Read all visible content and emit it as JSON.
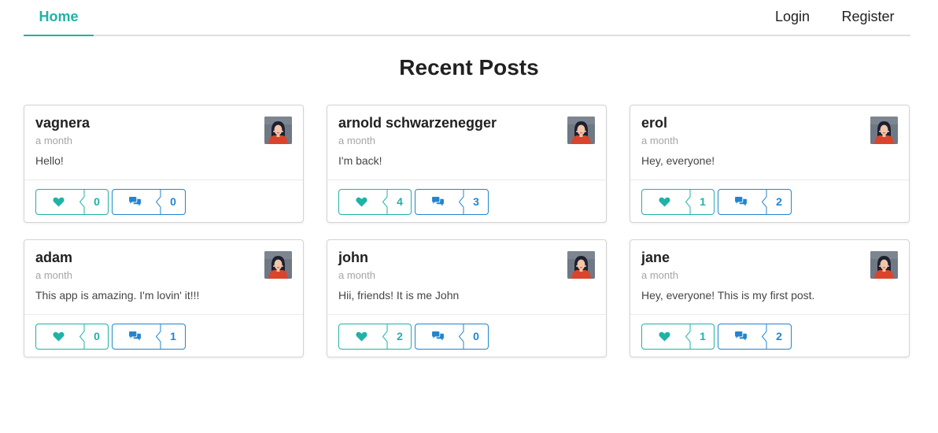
{
  "nav": {
    "home": "Home",
    "login": "Login",
    "register": "Register"
  },
  "page": {
    "title": "Recent Posts"
  },
  "colors": {
    "accent_teal": "#1fb2a6",
    "accent_blue": "#2185d0"
  },
  "icons": {
    "like": "heart-icon",
    "comment": "comments-icon",
    "avatar": "user-avatar"
  },
  "posts": [
    {
      "author": "vagnera",
      "time": "a month",
      "body": "Hello!",
      "likes": "0",
      "comments": "0"
    },
    {
      "author": "arnold schwarzenegger",
      "time": "a month",
      "body": "I'm back!",
      "likes": "4",
      "comments": "3"
    },
    {
      "author": "erol",
      "time": "a month",
      "body": "Hey, everyone!",
      "likes": "1",
      "comments": "2"
    },
    {
      "author": "adam",
      "time": "a month",
      "body": "This app is amazing. I'm lovin' it!!!",
      "likes": "0",
      "comments": "1"
    },
    {
      "author": "john",
      "time": "a month",
      "body": "Hii, friends! It is me John",
      "likes": "2",
      "comments": "0"
    },
    {
      "author": "jane",
      "time": "a month",
      "body": "Hey, everyone! This is my first post.",
      "likes": "1",
      "comments": "2"
    }
  ]
}
